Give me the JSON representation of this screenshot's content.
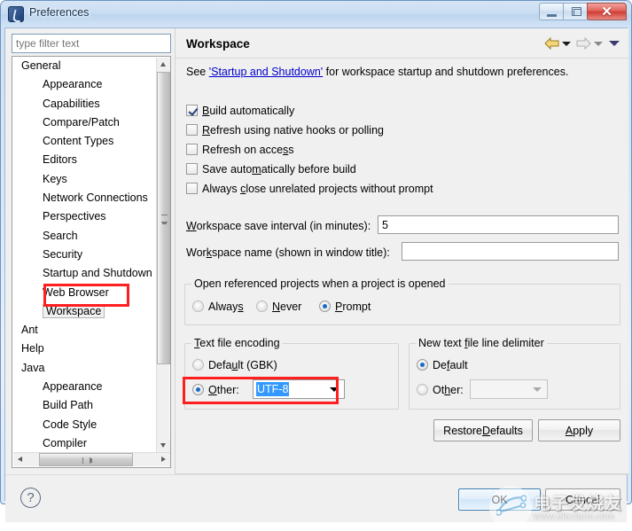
{
  "window": {
    "title": "Preferences",
    "app_icon": "eclipse-icon",
    "controls": {
      "minimize": "Minimize",
      "maximize": "Maximize",
      "close": "Close",
      "close_glyph": "✕"
    }
  },
  "filter": {
    "placeholder": "type filter text",
    "value": ""
  },
  "tree": {
    "items": [
      {
        "label": "General",
        "level": 1,
        "selected": false
      },
      {
        "label": "Appearance",
        "level": 2,
        "selected": false
      },
      {
        "label": "Capabilities",
        "level": 2,
        "selected": false
      },
      {
        "label": "Compare/Patch",
        "level": 2,
        "selected": false
      },
      {
        "label": "Content Types",
        "level": 2,
        "selected": false
      },
      {
        "label": "Editors",
        "level": 2,
        "selected": false
      },
      {
        "label": "Keys",
        "level": 2,
        "selected": false
      },
      {
        "label": "Network Connections",
        "level": 2,
        "selected": false
      },
      {
        "label": "Perspectives",
        "level": 2,
        "selected": false
      },
      {
        "label": "Search",
        "level": 2,
        "selected": false
      },
      {
        "label": "Security",
        "level": 2,
        "selected": false
      },
      {
        "label": "Startup and Shutdown",
        "level": 2,
        "selected": false
      },
      {
        "label": "Web Browser",
        "level": 2,
        "selected": false
      },
      {
        "label": "Workspace",
        "level": 2,
        "selected": true
      },
      {
        "label": "Ant",
        "level": 1,
        "selected": false
      },
      {
        "label": "Help",
        "level": 1,
        "selected": false
      },
      {
        "label": "Java",
        "level": 1,
        "selected": false
      },
      {
        "label": "Appearance",
        "level": 2,
        "selected": false
      },
      {
        "label": "Build Path",
        "level": 2,
        "selected": false
      },
      {
        "label": "Code Style",
        "level": 2,
        "selected": false
      },
      {
        "label": "Compiler",
        "level": 2,
        "selected": false
      }
    ]
  },
  "panel": {
    "title": "Workspace",
    "nav": {
      "back": "back-arrow",
      "back_menu": "back-dropdown",
      "forward": "forward-arrow",
      "forward_menu": "forward-dropdown",
      "menu": "view-menu"
    },
    "description": {
      "prefix": "See ",
      "link": "'Startup and Shutdown'",
      "suffix": " for workspace startup and shutdown preferences."
    },
    "checkboxes": [
      {
        "label_pre": "",
        "mnemonic": "B",
        "label_post": "uild automatically",
        "checked": true
      },
      {
        "label_pre": "",
        "mnemonic": "R",
        "label_post": "efresh using native hooks or polling",
        "checked": false
      },
      {
        "label_pre": "Refresh on acce",
        "mnemonic": "s",
        "label_post": "s",
        "checked": false
      },
      {
        "label_pre": "Save auto",
        "mnemonic": "m",
        "label_post": "atically before build",
        "checked": false
      },
      {
        "label_pre": "Always ",
        "mnemonic": "c",
        "label_post": "lose unrelated projects without prompt",
        "checked": false
      }
    ],
    "fields": [
      {
        "label_pre": "",
        "mnemonic": "W",
        "label_post": "orkspace save interval (in minutes):",
        "value": "5"
      },
      {
        "label_pre": "Wor",
        "mnemonic": "k",
        "label_post": "space name (shown in window title):",
        "value": ""
      }
    ],
    "open_referenced": {
      "title": "Open referenced projects when a project is opened",
      "options": [
        {
          "label_pre": "Alway",
          "mnemonic": "s",
          "label_post": "",
          "selected": false
        },
        {
          "label_pre": "",
          "mnemonic": "N",
          "label_post": "ever",
          "selected": false
        },
        {
          "label_pre": "",
          "mnemonic": "P",
          "label_post": "rompt",
          "selected": true
        }
      ]
    },
    "text_file_encoding": {
      "title_pre": "",
      "title_mn": "T",
      "title_post": "ext file encoding",
      "default_pre": "Defa",
      "default_mn": "u",
      "default_post": "lt (GBK)",
      "default_selected": false,
      "other_pre": "",
      "other_mn": "O",
      "other_post": "ther:",
      "other_selected": true,
      "combo_value": "UTF-8",
      "combo_selection_color": "#3399ff"
    },
    "line_delimiter": {
      "title_pre": "New text ",
      "title_mn": "f",
      "title_post": "ile line delimiter",
      "default_pre": "De",
      "default_mn": "f",
      "default_post": "ault",
      "default_selected": true,
      "other_pre": "Ot",
      "other_mn": "h",
      "other_post": "er:",
      "other_selected": false,
      "combo_value": "",
      "combo_disabled": true
    },
    "restore_defaults": {
      "pre": "Restore ",
      "mn": "D",
      "post": "efaults"
    },
    "apply": {
      "pre": "",
      "mn": "A",
      "post": "pply"
    }
  },
  "footer": {
    "help": "?",
    "ok": "OK",
    "cancel": "Cancel"
  },
  "watermark": {
    "cn_text": "电子发烧友",
    "url": "www.elecfans.com"
  },
  "annotations": {
    "accent_color": "#ff1f1f",
    "boxes": [
      {
        "target": "tree-item-workspace"
      },
      {
        "target": "text-file-encoding-other-row"
      }
    ]
  }
}
